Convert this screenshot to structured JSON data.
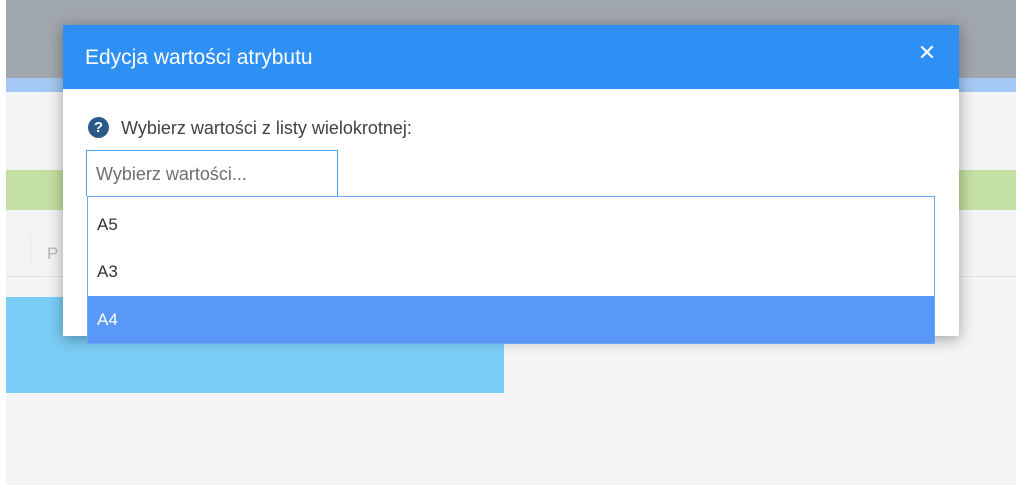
{
  "modal": {
    "title": "Edycja wartości atrybutu",
    "close_symbol": "✕",
    "help_icon": "question-circle-icon",
    "help_symbol": "?",
    "field_label": "Wybierz wartości z listy wielokrotnej:",
    "select_placeholder": "Wybierz wartości...",
    "options": [
      {
        "label": "A5",
        "highlighted": false
      },
      {
        "label": "A3",
        "highlighted": false
      },
      {
        "label": "A4",
        "highlighted": true
      }
    ]
  },
  "background": {
    "tab_label_partial": "P"
  },
  "colors": {
    "modal_header": "#2e8ff5",
    "highlight": "#5a98f7",
    "help_icon": "#2b5a8a",
    "green_bar": "#c3dfa2",
    "blue_card": "#7acdf6"
  }
}
